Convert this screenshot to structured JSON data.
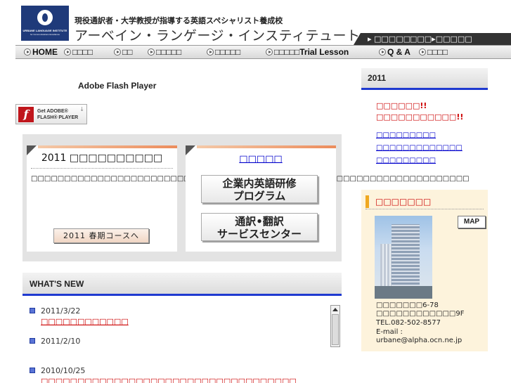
{
  "header": {
    "logo_line1": "URBANE LANGUAGE INSTITUTE",
    "logo_line2": "for Communications Excellence",
    "tagline": "現役通訳者・大学教授が指導する英語スペシャリスト養成校",
    "school_name": "アーベイン・ランゲージ・インスティテュート",
    "top_links": [
      "▸ □□□□□",
      "□□□▸□□□□□"
    ]
  },
  "nav": {
    "items": [
      "HOME",
      "□□□□",
      "□□",
      "□□□□□",
      "□□□□□",
      "□□□□□Trial Lesson",
      "Q & A",
      "□□□□"
    ]
  },
  "flash": {
    "label": "Adobe Flash Player",
    "badge_line1": "Get ADOBE®",
    "badge_line2": "FLASH® PLAYER",
    "download_icon": "↓"
  },
  "promo": {
    "card1_title": "2011 □□□□□□□□□□",
    "card1_body": "□□□□□□□□□□□□□□□□□□□□□□□□□□□□□□□□□□□□□□□□□□□□□□□□□□□□□□□□□□□□□□□□□□",
    "spring_button": "2011 春期コースへ",
    "card2_title": "□□□□□",
    "corporate_button_l1": "企業内英語研修",
    "corporate_button_l2": "プログラム",
    "translation_button_l1": "通訳•翻訳",
    "translation_button_l2": "サービスセンター"
  },
  "whats_new": {
    "title": "WHAT'S NEW",
    "items": [
      {
        "date": "2011/3/22",
        "link": "□□□□□□□□□□□□"
      },
      {
        "date": "2011/2/10",
        "link": ""
      },
      {
        "date": "2010/10/25",
        "link": "□□□□□□□□□□□□□□□□□□□□□□□□□□□□□□□□□□□"
      }
    ]
  },
  "sidebar": {
    "year": "2011",
    "red_line1": "□□□□□□!!",
    "red_line2": "□□□□□□□□□□□!!",
    "links": [
      "□□□□□□□□□",
      "□□□□□□□□□□□□□",
      "□□□□□□□□□"
    ],
    "access_title": "□□□□□□□",
    "map_button": "MAP",
    "address": [
      "□□□□□□□6-78",
      "□□□□□□□□□□□□9F",
      "TEL.082-502-8577",
      "E-mail :",
      "urbane@alpha.ocn.ne.jp"
    ]
  },
  "colors": {
    "accent_blue": "#1f3ad0",
    "link_red": "#cc0000",
    "link_blue": "#0000cc",
    "logo_navy": "#1f3a7a"
  }
}
